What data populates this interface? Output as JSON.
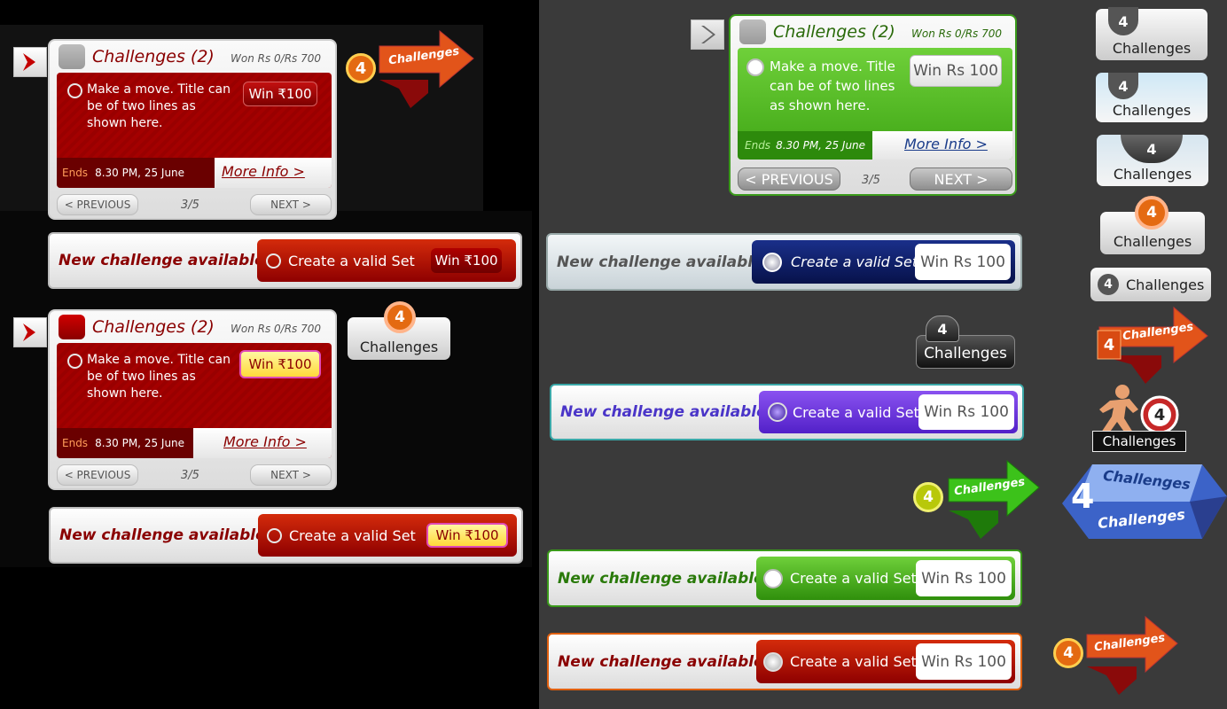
{
  "panels": {
    "title": "Challenges (2)",
    "won": "Won Rs 0/Rs 700",
    "description": "Make a move. Title can be of two lines as shown here.",
    "win_rupee": "Win ₹100",
    "win_rs": "Win Rs 100",
    "ends_label": "Ends",
    "ends_time": "8.30 PM, 25 June",
    "more_info": "More Info >",
    "previous": "< PREVIOUS",
    "next": "NEXT >",
    "page": "3/5"
  },
  "banners": {
    "text": "New challenge available",
    "create": "Create a valid Set",
    "win_rupee": "Win ₹100",
    "win_rs": "Win Rs 100"
  },
  "badges": {
    "count": "4",
    "label": "Challenges",
    "count_label": "4 Challenges"
  },
  "colors": {
    "red": "#a00000",
    "green": "#3ea514",
    "navy": "#0a1b5e",
    "purple": "#6a35d8",
    "orange": "#e06010",
    "yellow": "#ffe74a"
  }
}
